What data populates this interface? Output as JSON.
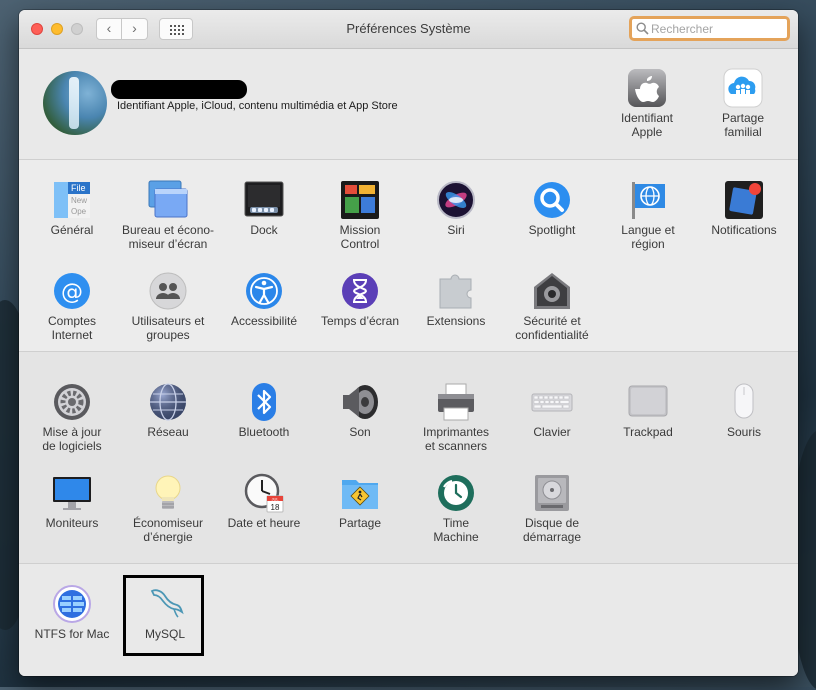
{
  "window": {
    "title": "Préférences Système",
    "search_placeholder": "Rechercher",
    "back_glyph": "‹",
    "forward_glyph": "›"
  },
  "account": {
    "description": "Identifiant Apple, iCloud, contenu multimédia et App Store",
    "items": [
      {
        "label": "Identifiant\nApple",
        "icon": "apple-id-icon"
      },
      {
        "label": "Partage\nfamilial",
        "icon": "family-sharing-icon"
      }
    ]
  },
  "personal": [
    {
      "label": "Général",
      "icon": "general-icon"
    },
    {
      "label": "Bureau et écono-\nmiseur d’écran",
      "icon": "desktop-screensaver-icon"
    },
    {
      "label": "Dock",
      "icon": "dock-icon"
    },
    {
      "label": "Mission\nControl",
      "icon": "mission-control-icon"
    },
    {
      "label": "Siri",
      "icon": "siri-icon"
    },
    {
      "label": "Spotlight",
      "icon": "spotlight-icon"
    },
    {
      "label": "Langue et\nrégion",
      "icon": "language-region-icon"
    },
    {
      "label": "Notifications",
      "icon": "notifications-icon"
    },
    {
      "label": "Comptes\nInternet",
      "icon": "internet-accounts-icon"
    },
    {
      "label": "Utilisateurs et\ngroupes",
      "icon": "users-groups-icon"
    },
    {
      "label": "Accessibilité",
      "icon": "accessibility-icon"
    },
    {
      "label": "Temps d’écran",
      "icon": "screen-time-icon"
    },
    {
      "label": "Extensions",
      "icon": "extensions-icon"
    },
    {
      "label": "Sécurité et\nconfidentialité",
      "icon": "security-privacy-icon"
    }
  ],
  "hardware": [
    {
      "label": "Mise à jour\nde logiciels",
      "icon": "software-update-icon"
    },
    {
      "label": "Réseau",
      "icon": "network-icon"
    },
    {
      "label": "Bluetooth",
      "icon": "bluetooth-icon"
    },
    {
      "label": "Son",
      "icon": "sound-icon"
    },
    {
      "label": "Imprimantes\net scanners",
      "icon": "printers-scanners-icon"
    },
    {
      "label": "Clavier",
      "icon": "keyboard-icon"
    },
    {
      "label": "Trackpad",
      "icon": "trackpad-icon"
    },
    {
      "label": "Souris",
      "icon": "mouse-icon"
    },
    {
      "label": "Moniteurs",
      "icon": "displays-icon"
    },
    {
      "label": "Économiseur\nd’énergie",
      "icon": "energy-saver-icon"
    },
    {
      "label": "Date et heure",
      "icon": "date-time-icon"
    },
    {
      "label": "Partage",
      "icon": "sharing-icon"
    },
    {
      "label": "Time\nMachine",
      "icon": "time-machine-icon"
    },
    {
      "label": "Disque de\ndémarrage",
      "icon": "startup-disk-icon"
    }
  ],
  "other": [
    {
      "label": "NTFS for Mac",
      "icon": "ntfs-for-mac-icon"
    },
    {
      "label": "MySQL",
      "icon": "mysql-icon"
    }
  ],
  "icon_text": {
    "general_file": "File",
    "general_new": "New",
    "general_open": "Ope",
    "calendar_month": "JUL",
    "calendar_day": "18"
  },
  "colors": {
    "search_focus": "#e4a35a",
    "highlight_box": "#000000",
    "close": "#fe5f57",
    "minimize": "#febc2e"
  }
}
